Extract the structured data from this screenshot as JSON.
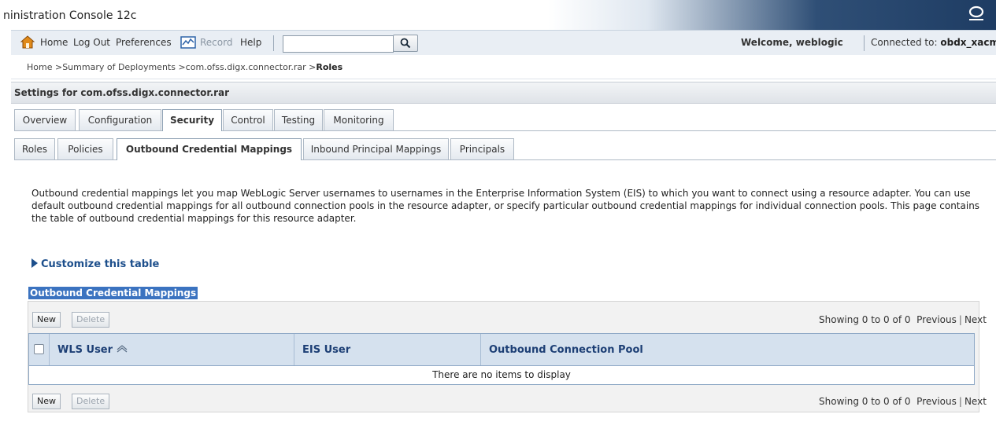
{
  "window": {
    "title": "ninistration Console 12c"
  },
  "toolbar": {
    "home": "Home",
    "logout": "Log Out",
    "preferences": "Preferences",
    "record": "Record",
    "help": "Help",
    "search_value": "",
    "welcome": "Welcome, weblogic",
    "connected_label": "Connected to:",
    "connected_value": "obdx_xacm"
  },
  "breadcrumb": {
    "path": "Home >Summary of Deployments >com.ofss.digx.connector.rar >",
    "current": "Roles"
  },
  "settings": {
    "title": "Settings for com.ofss.digx.connector.rar"
  },
  "tabs": [
    {
      "label": "Overview",
      "active": false
    },
    {
      "label": "Configuration",
      "active": false
    },
    {
      "label": "Security",
      "active": true
    },
    {
      "label": "Control",
      "active": false
    },
    {
      "label": "Testing",
      "active": false
    },
    {
      "label": "Monitoring",
      "active": false
    }
  ],
  "subtabs": [
    {
      "label": "Roles",
      "active": false
    },
    {
      "label": "Policies",
      "active": false
    },
    {
      "label": "Outbound Credential Mappings",
      "active": true
    },
    {
      "label": "Inbound Principal Mappings",
      "active": false
    },
    {
      "label": "Principals",
      "active": false
    }
  ],
  "description": "Outbound credential mappings let you map WebLogic Server usernames to usernames in the Enterprise Information System (EIS) to which you want to connect using a resource adapter. You can use default outbound credential mappings for all outbound connection pools in the resource adapter, or specify particular outbound credential mappings for individual connection pools. This page contains the table of outbound credential mappings for this resource adapter.",
  "customize": "Customize this table",
  "table": {
    "title": "Outbound Credential Mappings",
    "new_label": "New",
    "delete_label": "Delete",
    "showing": "Showing 0 to 0 of 0",
    "previous": "Previous",
    "next": "Next",
    "columns": [
      "WLS User",
      "EIS User",
      "Outbound Connection Pool"
    ],
    "empty_message": "There are no items to display"
  }
}
